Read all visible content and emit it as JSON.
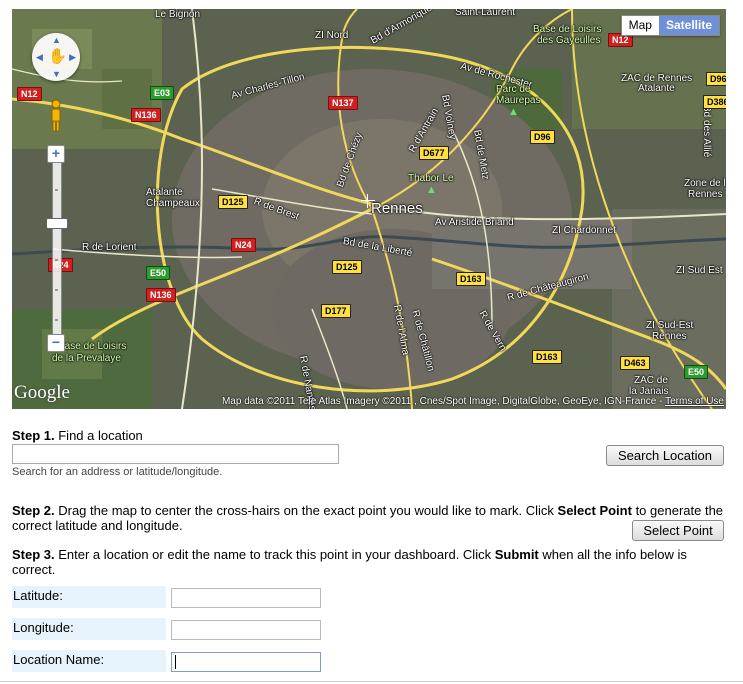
{
  "map": {
    "type_buttons": {
      "map": "Map",
      "satellite": "Satellite"
    },
    "logo": "Google",
    "copyright": "Map data ©2011 Tele Atlas Imagery ©2011 , Cnes/Spot Image, DigitalGlobe, GeoEye, IGN-France -",
    "terms": "Terms of Use",
    "city": "Rennes",
    "places": {
      "le_bignon": "Le Bignon",
      "saint_laurent": "Saint-Laurent",
      "base_loisirs": "Base de Loisirs",
      "des_gayeulles": "des Gayeulles",
      "zi_nord": "ZI Nord",
      "bd_armorique": "Bd d'Armorique",
      "av_rochester": "Av de Rochester",
      "zac_rennes": "ZAC de Rennes",
      "atalante": "Atalante",
      "av_charles_tillon": "Av Charles-Tillon",
      "parc_de": "Parc de",
      "maurepas": "Maurepas",
      "bd_des_alliés": "Bd des Allié",
      "thabor": "Thabor Le",
      "zone_de": "Zone de la",
      "beaulieu": "Rennes",
      "atalante_champeaux": "Atalante",
      "champeaux": "Champeaux",
      "r_de_brest": "R de Brest",
      "av_aristide_briand": "Av Aristide Briand",
      "zi_chardonnet": "ZI Chardonnet",
      "r_de_lorient": "R de Lorient",
      "bd_liberte": "Bd de la Liberté",
      "zi_sud_est": "ZI Sud Est",
      "r_chateaugiron": "R de Châteaugiron",
      "zi_sud_est_rennes1": "ZI Sud-Est",
      "zi_sud_est_rennes2": "Rennes",
      "base_loisirs2": "Base de Loisirs",
      "prevalaye": "de la Prevalaye",
      "zac_de": "ZAC de",
      "la_janais": "la Janais",
      "r_de_vern": "R de Vern",
      "r_alma": "R de l'Alma",
      "r_chatillon": "R de Châtillon",
      "r_nantes": "R de Nantes",
      "bd_de_chezy": "Bd de Chézy",
      "r_antrain": "R d'Antrain",
      "bd_volney": "Bd Volney",
      "bd_de_metz": "Bd de Metz"
    },
    "shields": {
      "n12a": "N12",
      "n12b": "N12",
      "e03": "E03",
      "n136a": "N136",
      "n137": "N137",
      "d96a": "D96",
      "d96b": "D96",
      "d386": "D386",
      "d677": "D677",
      "d125a": "D125",
      "d125b": "D125",
      "n24": "N24",
      "n24b": "N24",
      "e50a": "E50",
      "e50b": "E50",
      "n136b": "N136",
      "d163a": "D163",
      "d163b": "D163",
      "d177": "D177",
      "d463": "D463"
    }
  },
  "form": {
    "step1": {
      "label": "Step 1.",
      "text": " Find a location"
    },
    "search_placeholder": "",
    "search_hint": "Search for an address or latitude/longitude.",
    "search_button": "Search Location",
    "step2": {
      "label": "Step 2.",
      "text_a": " Drag the map to center the cross-hairs on the exact point you would like to mark. Click ",
      "bold": "Select Point",
      "text_b": " to generate the correct latitude and longitude."
    },
    "select_button": "Select Point",
    "step3": {
      "label": "Step 3.",
      "text_a": " Enter a location or edit the name to track this point in your dashboard. Click ",
      "bold": "Submit",
      "text_b": " when all the info below is correct."
    },
    "fields": {
      "latitude": {
        "label": "Latitude:",
        "value": ""
      },
      "longitude": {
        "label": "Longitude:",
        "value": ""
      },
      "location_name": {
        "label": "Location Name:",
        "value": ""
      }
    }
  }
}
